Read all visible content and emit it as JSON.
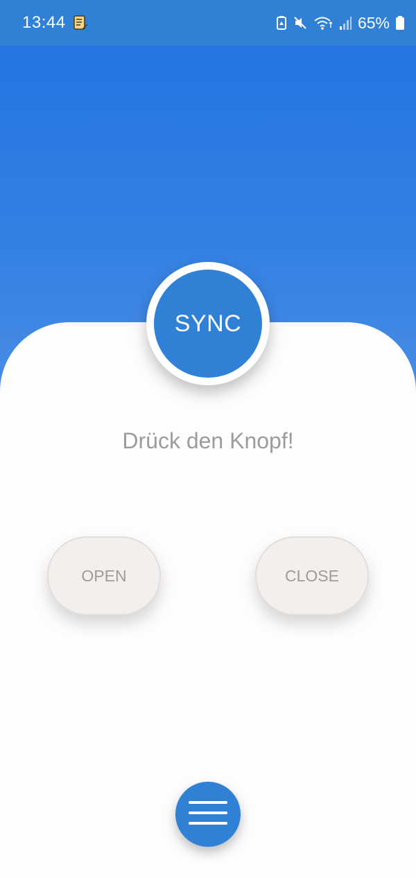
{
  "status_bar": {
    "time": "13:44",
    "battery_percent": "65%",
    "icons": [
      "document-notification-icon",
      "saver-icon",
      "mute-icon",
      "wifi-icon",
      "signal-icon",
      "battery-icon"
    ]
  },
  "main": {
    "sync_label": "SYNC",
    "prompt": "Drück den Knopf!",
    "open_label": "OPEN",
    "close_label": "CLOSE"
  },
  "menu": {
    "icon": "hamburger-menu-icon"
  },
  "colors": {
    "primary": "#3080d6",
    "gradient_top": "#2574e2",
    "pill_bg": "#f2efed",
    "text_muted": "#9d9b9b"
  }
}
